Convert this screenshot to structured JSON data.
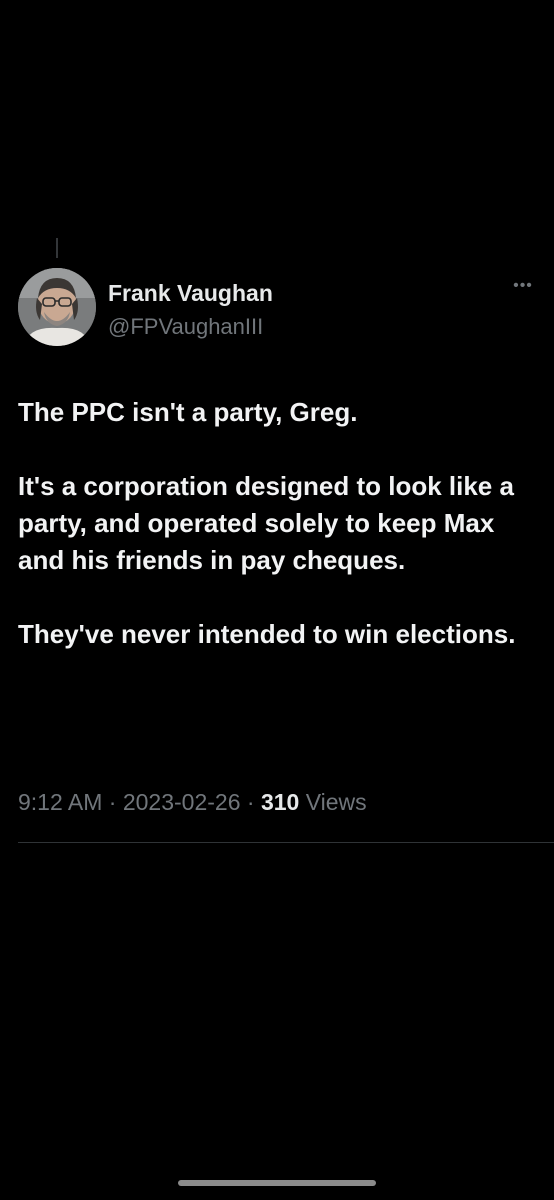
{
  "author": {
    "name": "Frank Vaughan",
    "handle": "@FPVaughanIII",
    "avatar_icon": "user-photo-avatar"
  },
  "tweet": {
    "paragraphs": [
      "The PPC isn't a party, Greg.",
      "It's a corporation designed to look like a party, and operated solely to keep Max and his friends in pay cheques.",
      "They've never intended to win elections."
    ],
    "time": "9:12 AM",
    "date": "2023-02-26",
    "separator": "·",
    "views_count": "310",
    "views_label": "Views"
  },
  "more_menu_icon": "more-dots-icon",
  "colors": {
    "background": "#000000",
    "primary_text": "#e7e9ea",
    "secondary_text": "#71767b",
    "divider": "#2f3336"
  }
}
